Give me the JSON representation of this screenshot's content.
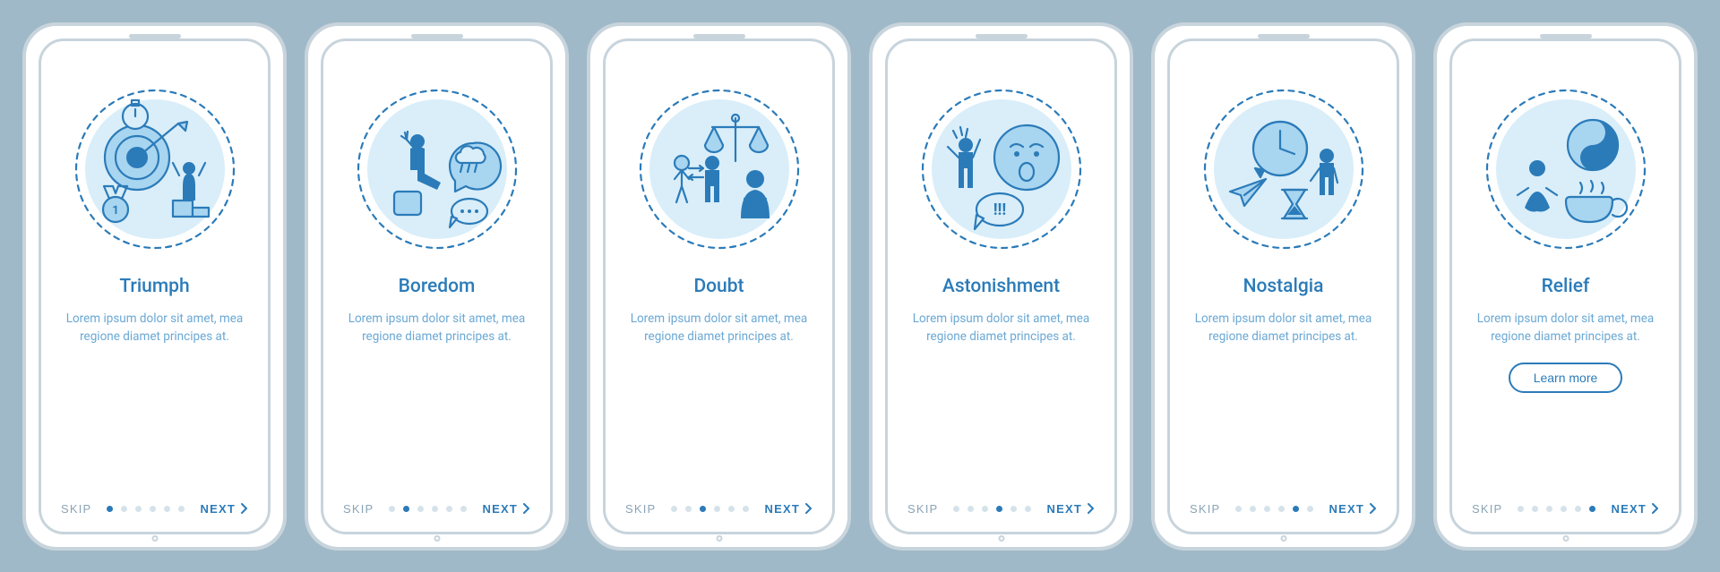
{
  "common": {
    "skip": "SKIP",
    "next": "NEXT",
    "body": "Lorem ipsum dolor sit amet, mea regione diamet principes at.",
    "learn_more": "Learn more",
    "total_dots": 6
  },
  "screens": [
    {
      "title": "Triumph",
      "active_index": 0,
      "icon": "triumph-icon",
      "learn_more": false
    },
    {
      "title": "Boredom",
      "active_index": 1,
      "icon": "boredom-icon",
      "learn_more": false
    },
    {
      "title": "Doubt",
      "active_index": 2,
      "icon": "doubt-icon",
      "learn_more": false
    },
    {
      "title": "Astonishment",
      "active_index": 3,
      "icon": "astonishment-icon",
      "learn_more": false
    },
    {
      "title": "Nostalgia",
      "active_index": 4,
      "icon": "nostalgia-icon",
      "learn_more": false
    },
    {
      "title": "Relief",
      "active_index": 5,
      "icon": "relief-icon",
      "learn_more": true
    }
  ],
  "colors": {
    "background": "#a0b9c8",
    "accent": "#2b7bb9",
    "accent_light": "#6aa8d4"
  }
}
